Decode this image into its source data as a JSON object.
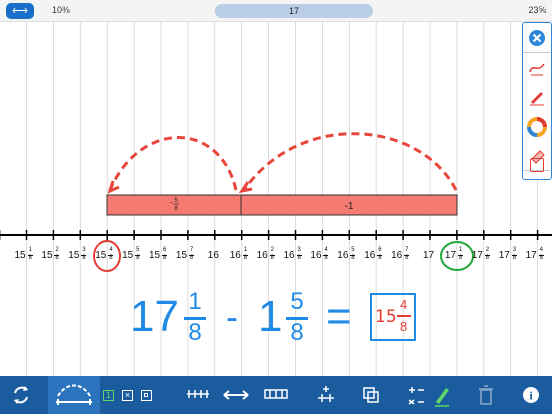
{
  "header": {
    "range_left": "10⅜",
    "center_value": "17",
    "range_right": "23⅝"
  },
  "number_line": {
    "ticks": [
      {
        "whole": "15",
        "num": "1",
        "den": "8"
      },
      {
        "whole": "15",
        "num": "2",
        "den": "8"
      },
      {
        "whole": "15",
        "num": "3",
        "den": "8"
      },
      {
        "whole": "15",
        "num": "4",
        "den": "8"
      },
      {
        "whole": "15",
        "num": "5",
        "den": "8"
      },
      {
        "whole": "15",
        "num": "6",
        "den": "8"
      },
      {
        "whole": "15",
        "num": "7",
        "den": "8"
      },
      {
        "whole": "16",
        "num": "",
        "den": ""
      },
      {
        "whole": "16",
        "num": "1",
        "den": "8"
      },
      {
        "whole": "16",
        "num": "2",
        "den": "8"
      },
      {
        "whole": "16",
        "num": "3",
        "den": "8"
      },
      {
        "whole": "16",
        "num": "4",
        "den": "8"
      },
      {
        "whole": "16",
        "num": "5",
        "den": "8"
      },
      {
        "whole": "16",
        "num": "6",
        "den": "8"
      },
      {
        "whole": "16",
        "num": "7",
        "den": "8"
      },
      {
        "whole": "17",
        "num": "",
        "den": ""
      },
      {
        "whole": "17",
        "num": "1",
        "den": "8"
      },
      {
        "whole": "17",
        "num": "2",
        "den": "8"
      },
      {
        "whole": "17",
        "num": "3",
        "den": "8"
      },
      {
        "whole": "17",
        "num": "4",
        "den": "8"
      }
    ],
    "bar_left_label_num": "5",
    "bar_left_label_den": "8",
    "bar_right_label": "-1"
  },
  "equation": {
    "whole1": "17",
    "num1": "1",
    "den1": "8",
    "minus": "-",
    "whole2": "1",
    "num2": "5",
    "den2": "8",
    "equals": "=",
    "answer_whole": "15",
    "answer_num": "4",
    "answer_den": "8"
  },
  "toolbar": {
    "mode_1": "1"
  },
  "colors": {
    "accent": "#1f8be6",
    "bar_fill": "#f47a72",
    "arrow": "#e8463a",
    "red_circle": "#e33b32",
    "green_circle": "#22a63a",
    "toolbar_bg": "#1b5c9e"
  }
}
